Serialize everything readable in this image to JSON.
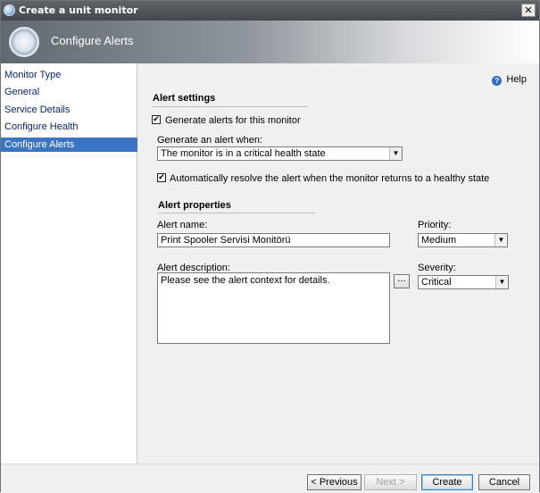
{
  "window": {
    "title": "Create a unit monitor",
    "close_icon": "close-icon"
  },
  "banner": {
    "heading": "Configure Alerts",
    "icon": "monitor-ring-icon"
  },
  "sidebar": {
    "items": [
      {
        "label": "Monitor Type"
      },
      {
        "label": "General"
      },
      {
        "label": "Service Details"
      },
      {
        "label": "Configure Health"
      },
      {
        "label": "Configure Alerts",
        "active": true
      }
    ]
  },
  "help": {
    "label": "Help",
    "icon": "help-icon"
  },
  "alert_settings": {
    "title": "Alert settings",
    "generate_checkbox_label": "Generate alerts for this monitor",
    "generate_checked": true,
    "generate_when_label": "Generate an alert when:",
    "generate_when_value": "The monitor is in a critical health state",
    "auto_resolve_label": "Automatically resolve the alert when the monitor returns to a healthy state",
    "auto_resolve_checked": true
  },
  "alert_properties": {
    "title": "Alert properties",
    "name_label": "Alert name:",
    "name_value": "Print Spooler Servisi Monitörü",
    "priority_label": "Priority:",
    "priority_value": "Medium",
    "description_label": "Alert description:",
    "description_value": "Please see the alert context for details.",
    "ellipsis_label": "...",
    "severity_label": "Severity:",
    "severity_value": "Critical"
  },
  "footer": {
    "previous_label": "< Previous",
    "next_label": "Next >",
    "create_label": "Create",
    "cancel_label": "Cancel"
  },
  "colors": {
    "titlebar": "#4f5459",
    "sidebar_active": "#3a75c4",
    "nav_link": "#0a246a"
  }
}
